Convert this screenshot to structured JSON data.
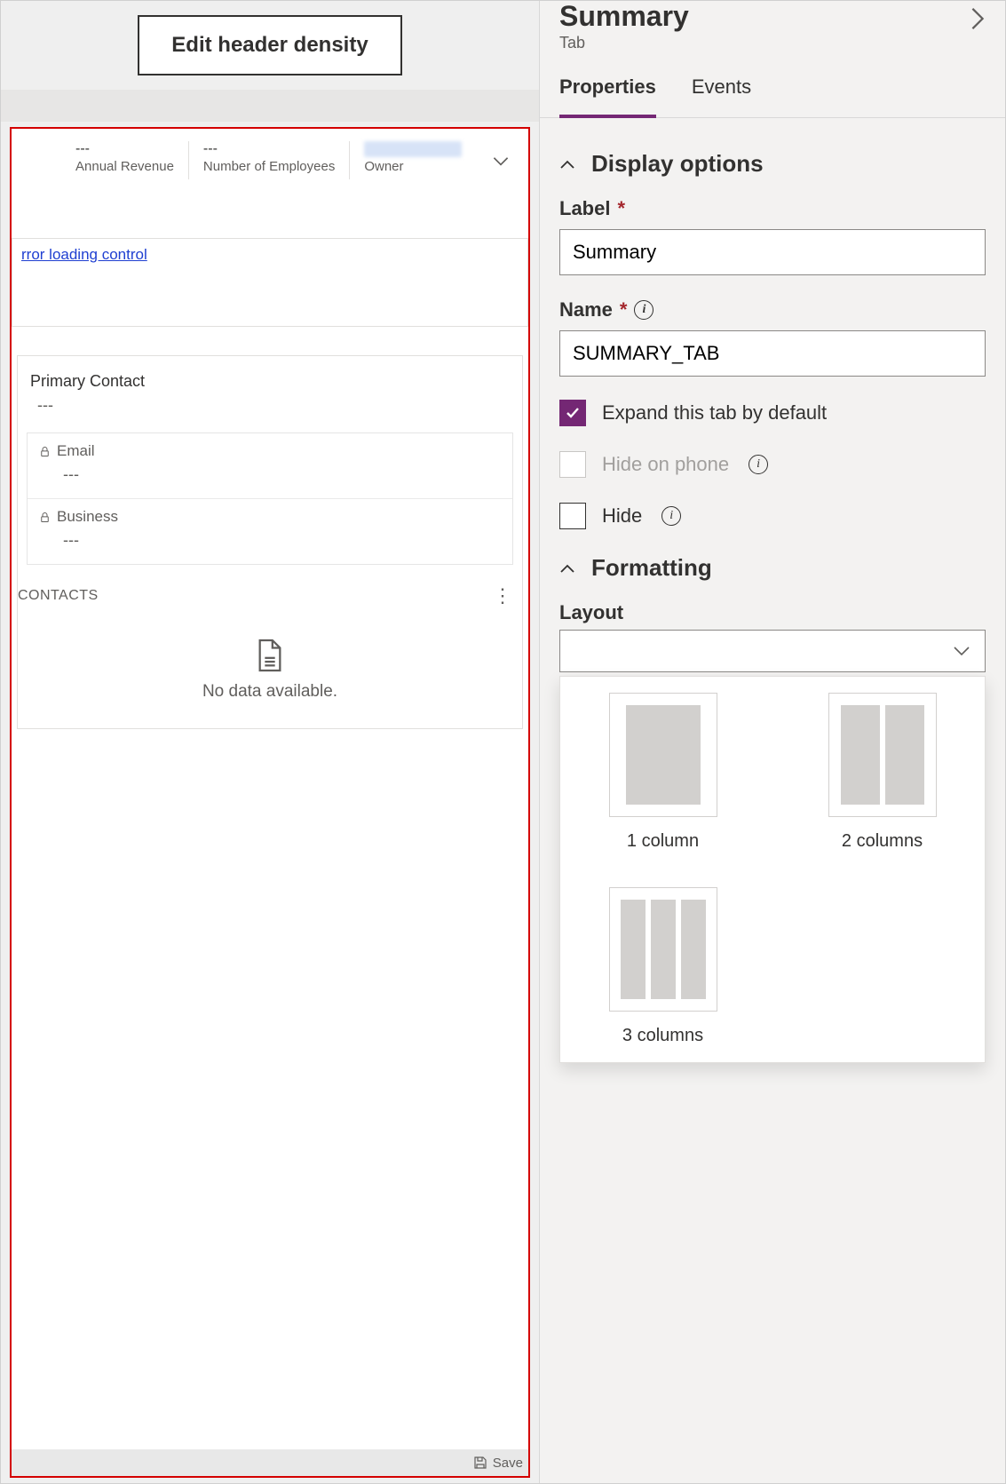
{
  "left": {
    "edit_header_button": "Edit header density",
    "header_fields": [
      {
        "value": "---",
        "label": "Annual Revenue"
      },
      {
        "value": "---",
        "label": "Number of Employees"
      },
      {
        "value": "",
        "label": "Owner"
      }
    ],
    "error_link_text": "rror loading control",
    "primary_contact": {
      "label": "Primary Contact",
      "value": "---"
    },
    "email": {
      "label": "Email",
      "value": "---"
    },
    "business": {
      "label": "Business",
      "value": "---"
    },
    "contacts_heading": "CONTACTS",
    "no_data_text": "No data available.",
    "save_label": "Save"
  },
  "right": {
    "title": "Summary",
    "subtitle": "Tab",
    "tabs": {
      "properties": "Properties",
      "events": "Events"
    },
    "section_display": "Display options",
    "label_field": {
      "label": "Label",
      "value": "Summary"
    },
    "name_field": {
      "label": "Name",
      "value": "SUMMARY_TAB"
    },
    "expand_check": "Expand this tab by default",
    "hide_phone_check": "Hide on phone",
    "hide_check": "Hide",
    "section_formatting": "Formatting",
    "layout_label": "Layout",
    "layout_options": [
      {
        "key": "one",
        "label": "1 column"
      },
      {
        "key": "two",
        "label": "2 columns"
      },
      {
        "key": "three",
        "label": "3 columns"
      }
    ]
  }
}
